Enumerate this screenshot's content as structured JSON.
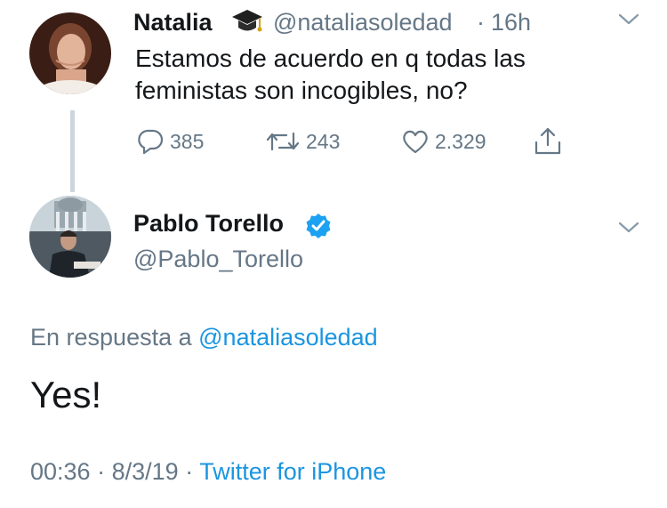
{
  "tweet1": {
    "name": "Natalia",
    "name_badge_icon": "graduation-cap-icon",
    "handle": "@nataliasoledad",
    "separator": "·",
    "time": "16h",
    "text": "Estamos de acuerdo en q todas las feministas son incogibles, no?",
    "replies": "385",
    "retweets": "243",
    "likes": "2.329"
  },
  "tweet2": {
    "name": "Pablo Torello",
    "verified_icon": "verified-badge-icon",
    "handle": "@Pablo_Torello",
    "reply_prefix": "En respuesta a",
    "reply_handle": "@nataliasoledad",
    "text": "Yes!",
    "time": "00:36",
    "date": "8/3/19",
    "separator": "·",
    "source": "Twitter for iPhone"
  },
  "colors": {
    "text": "#14171a",
    "muted": "#657786",
    "link": "#1b95e0",
    "verified": "#1da1f2",
    "thread_line": "#ccd6dd"
  }
}
